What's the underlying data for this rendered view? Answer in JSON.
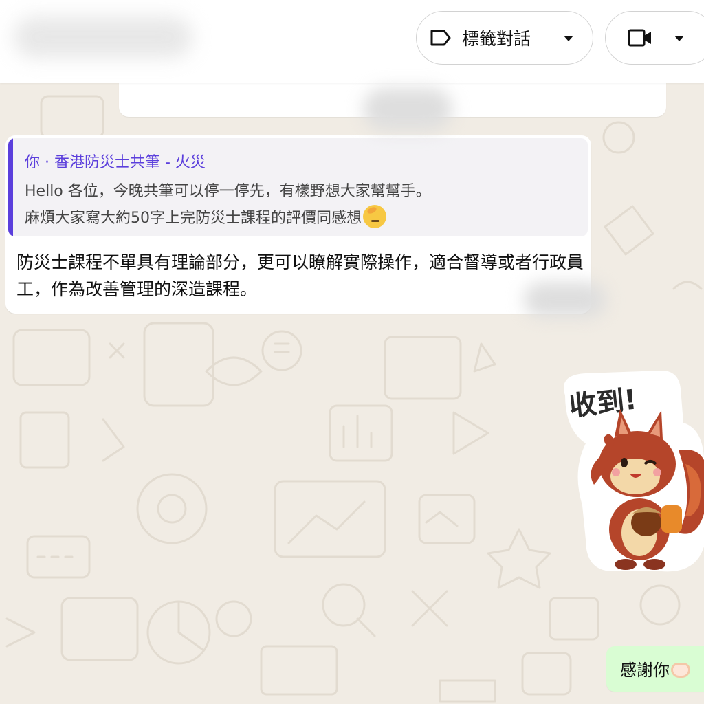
{
  "header": {
    "label_button_text": "標籤對話",
    "icons": {
      "label": "label-tag-icon",
      "video": "video-camera-icon",
      "dropdown": "caret-down-icon"
    }
  },
  "messages": [
    {
      "direction": "incoming",
      "quote": {
        "author": "你 · 香港防災士共筆 - 火災",
        "line1": "Hello 各位，今晚共筆可以停一停先，有樣野想大家幫幫手。",
        "line2": "麻煩大家寫大約50字上完防災士課程的評價同感想"
      },
      "body": "防災士課程不單具有理論部分，更可以瞭解實際操作，適合督導或者行政員工，作為改善管理的深造課程。"
    },
    {
      "direction": "outgoing",
      "type": "sticker",
      "text": "收到!",
      "character": "squirrel-saluting"
    },
    {
      "direction": "outgoing",
      "text": "感謝你"
    }
  ],
  "colors": {
    "chat_background": "#f1ece4",
    "quote_accent": "#5b3fdc",
    "outgoing_bubble": "#d9fdd3",
    "incoming_bubble": "#ffffff"
  }
}
